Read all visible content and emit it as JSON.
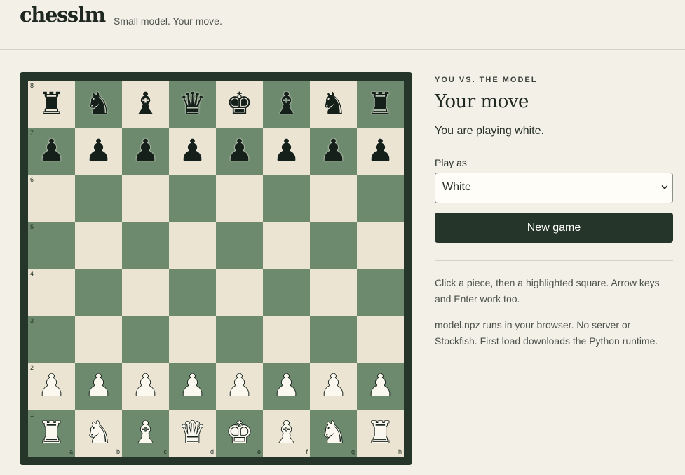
{
  "header": {
    "logo": "chesslm",
    "tagline": "Small model. Your move."
  },
  "board": {
    "files": [
      "a",
      "b",
      "c",
      "d",
      "e",
      "f",
      "g",
      "h"
    ],
    "ranks": [
      "8",
      "7",
      "6",
      "5",
      "4",
      "3",
      "2",
      "1"
    ],
    "rows": [
      [
        "♜",
        "♞",
        "♝",
        "♛",
        "♚",
        "♝",
        "♞",
        "♜"
      ],
      [
        "♟",
        "♟",
        "♟",
        "♟",
        "♟",
        "♟",
        "♟",
        "♟"
      ],
      [
        "",
        "",
        "",
        "",
        "",
        "",
        "",
        ""
      ],
      [
        "",
        "",
        "",
        "",
        "",
        "",
        "",
        ""
      ],
      [
        "",
        "",
        "",
        "",
        "",
        "",
        "",
        ""
      ],
      [
        "",
        "",
        "",
        "",
        "",
        "",
        "",
        ""
      ],
      [
        "♟",
        "♟",
        "♟",
        "♟",
        "♟",
        "♟",
        "♟",
        "♟"
      ],
      [
        "♜",
        "♞",
        "♝",
        "♛",
        "♚",
        "♝",
        "♞",
        "♜"
      ]
    ],
    "colors": [
      [
        "b",
        "b",
        "b",
        "b",
        "b",
        "b",
        "b",
        "b"
      ],
      [
        "b",
        "b",
        "b",
        "b",
        "b",
        "b",
        "b",
        "b"
      ],
      [
        "",
        "",
        "",
        "",
        "",
        "",
        "",
        ""
      ],
      [
        "",
        "",
        "",
        "",
        "",
        "",
        "",
        ""
      ],
      [
        "",
        "",
        "",
        "",
        "",
        "",
        "",
        ""
      ],
      [
        "",
        "",
        "",
        "",
        "",
        "",
        "",
        ""
      ],
      [
        "w",
        "w",
        "w",
        "w",
        "w",
        "w",
        "w",
        "w"
      ],
      [
        "w",
        "w",
        "w",
        "w",
        "w",
        "w",
        "w",
        "w"
      ]
    ],
    "light_square_color": "#ece4d3",
    "dark_square_color": "#6d8a6e",
    "frame_color": "#26352a"
  },
  "panel": {
    "eyebrow": "YOU VS. THE MODEL",
    "status_title": "Your move",
    "status_sub": "You are playing white.",
    "play_as_label": "Play as",
    "play_as_value": "White",
    "new_game_label": "New game",
    "help_text": "Click a piece, then a highlighted square. Arrow keys and Enter work too.",
    "runtime_text": "model.npz runs in your browser. No server or Stockfish. First load downloads the Python runtime."
  },
  "colors": {
    "background": "#f3f0e8",
    "accent": "#26352a"
  }
}
